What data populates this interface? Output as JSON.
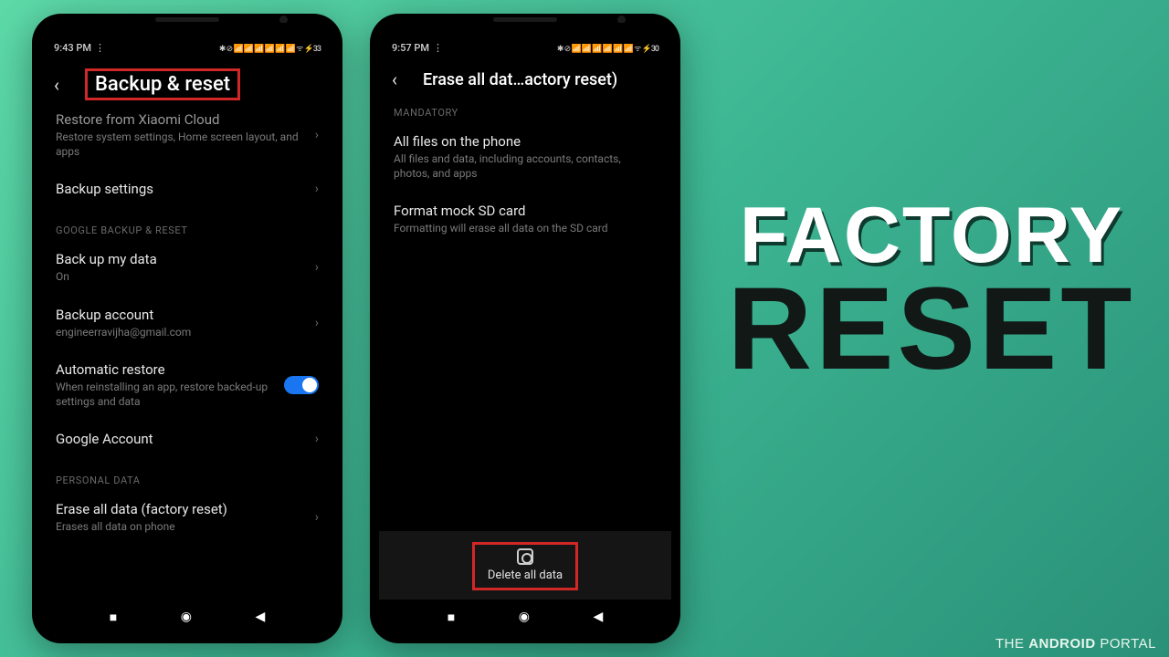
{
  "phone1": {
    "time": "9:43 PM",
    "status_icons": "⋮",
    "status_right": "✱ ⊘ 📶 📶 📶 📶 📶 📶 ᯤ ⚡33",
    "header": "Backup & reset",
    "rows": {
      "restore_cloud_title": "Restore from Xiaomi Cloud",
      "restore_cloud_sub": "Restore system settings, Home screen layout, and apps",
      "backup_settings": "Backup settings",
      "section_google": "GOOGLE BACKUP & RESET",
      "backup_data_title": "Back up my data",
      "backup_data_sub": "On",
      "backup_account_title": "Backup account",
      "backup_account_sub": "engineerravijha@gmail.com",
      "auto_restore_title": "Automatic restore",
      "auto_restore_sub": "When reinstalling an app, restore backed-up settings and data",
      "google_account": "Google Account",
      "section_personal": "PERSONAL DATA",
      "erase_title": "Erase all data (factory reset)",
      "erase_sub": "Erases all data on phone"
    }
  },
  "phone2": {
    "time": "9:57 PM",
    "status_icons": "⋮",
    "status_right": "✱ ⊘ 📶 📶 📶 📶 📶 📶 ᯤ ⚡30",
    "header": "Erase all dat…actory reset)",
    "section_mandatory": "MANDATORY",
    "all_files_title": "All files on the phone",
    "all_files_sub": "All files and data, including accounts, contacts, photos, and apps",
    "format_sd_title": "Format mock SD card",
    "format_sd_sub": "Formatting will erase all data on the SD card",
    "delete_label": "Delete all data"
  },
  "hero": {
    "line1": "FACTORY",
    "line2": "RESET"
  },
  "watermark": {
    "pre": "THE ",
    "bold": "ANDROID",
    "post": " PORTAL"
  }
}
